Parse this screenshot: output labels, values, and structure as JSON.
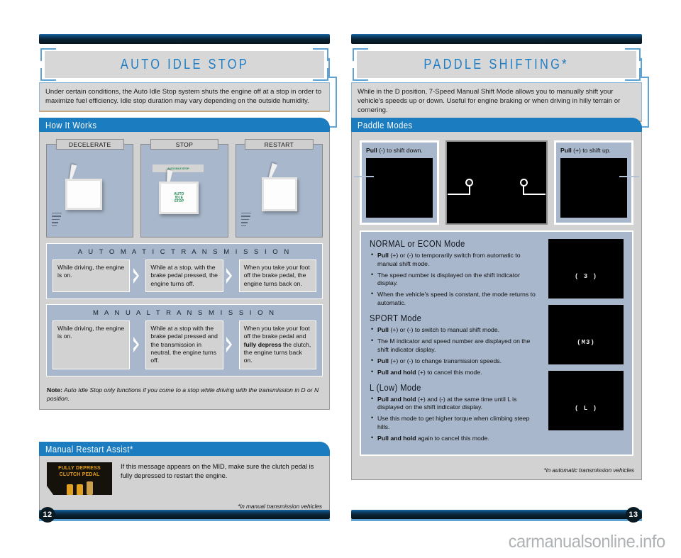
{
  "left_page": {
    "page_number": "12",
    "title": "AUTO IDLE STOP",
    "intro": "Under certain conditions, the Auto Idle Stop system shuts the engine off at a stop in order to maximize fuel efficiency. Idle stop duration may vary depending on the outside humidity.",
    "how_it_works": {
      "header": "How It Works",
      "gauges": [
        {
          "tab": "DECELERATE",
          "display_text": ""
        },
        {
          "tab": "STOP",
          "display_text": "AUTO IDLE STOP"
        },
        {
          "tab": "RESTART",
          "display_text": ""
        }
      ],
      "flows": [
        {
          "title": "A U T O M A T I C   T R A N S M I S S I O N",
          "steps": [
            "While driving, the engine is on.",
            "While at a stop, with the brake pedal pressed, the engine turns off.",
            "When you take your foot off the brake pedal, the engine turns back on."
          ]
        },
        {
          "title": "M A N U A L   T R A N S M I S S I O N",
          "steps": [
            "While driving, the engine is on.",
            "While at a stop with the brake pedal pressed and the transmission in neutral, the engine turns off.",
            "When you take your foot off the brake pedal and fully depress the clutch, the engine turns back on."
          ]
        }
      ],
      "note_label": "Note:",
      "note_text": " Auto Idle Stop only functions if you come to a stop while driving with the transmission in D or N position."
    },
    "manual_restart_assist": {
      "header": "Manual Restart Assist*",
      "mid_line1": "FULLY DEPRESS",
      "mid_line2": "CLUTCH PEDAL",
      "body": "If this message appears on the MID, make sure the clutch pedal is fully depressed to restart the engine.",
      "footnote": "*in manual transmission vehicles"
    }
  },
  "right_page": {
    "page_number": "13",
    "title": "PADDLE SHIFTING*",
    "intro": "While in the D position, 7-Speed Manual Shift Mode allows you to manually shift your vehicle's speeds up or down. Useful for engine braking or when driving in hilly terrain or cornering.",
    "paddle_modes": {
      "header": "Paddle Modes",
      "left_caption_strong": "Pull",
      "left_caption_rest": " (-) to shift down.",
      "right_caption_strong": "Pull",
      "right_caption_rest": " (+) to shift up.",
      "modes": [
        {
          "name": "NORMAL or ECON Mode",
          "indicator": "( 3 )",
          "bullets": [
            {
              "strong": "Pull",
              "rest": " (+) or (-) to temporarily switch from automatic to manual shift mode."
            },
            {
              "strong": "",
              "rest": "The speed number is displayed on the shift indicator display."
            },
            {
              "strong": "",
              "rest": "When the vehicle's speed is constant, the mode returns to automatic."
            }
          ]
        },
        {
          "name": "SPORT Mode",
          "indicator": "(M3)",
          "bullets": [
            {
              "strong": "Pull",
              "rest": " (+) or (-) to switch to manual shift mode."
            },
            {
              "strong": "",
              "rest": "The M indicator and speed number are displayed on the shift indicator display."
            },
            {
              "strong": "Pull",
              "rest": " (+) or (-) to change transmission speeds."
            },
            {
              "strong": "Pull and hold",
              "rest": " (+) to cancel this mode."
            }
          ]
        },
        {
          "name": "L (Low) Mode",
          "indicator": "( L )",
          "bullets": [
            {
              "strong": "Pull and hold",
              "rest": " (+) and (-) at the same time until L is displayed on the shift indicator display."
            },
            {
              "strong": "",
              "rest": "Use this mode to get higher torque when climbing steep hills."
            },
            {
              "strong": "Pull and hold",
              "rest": " again to cancel this mode."
            }
          ]
        }
      ],
      "footnote": "*in automatic transmission vehicles"
    }
  },
  "watermark": "carmanualsonline.info",
  "colors": {
    "accent_blue": "#1b7cc0",
    "title_blue": "#1f7dc4",
    "bracket_blue": "#5fa3d4",
    "panel_gray": "#d2d2d2",
    "flow_blue_gray": "#a8b7cb",
    "mid_amber": "#e8a21a"
  }
}
